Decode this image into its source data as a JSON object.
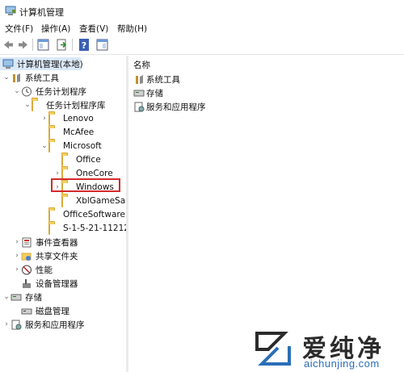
{
  "window": {
    "title": "计算机管理"
  },
  "menu": [
    "文件(F)",
    "操作(A)",
    "查看(V)",
    "帮助(H)"
  ],
  "toolbar": {
    "buttons": [
      "back-arrow-icon",
      "forward-arrow-icon",
      "show-hide-console-tree-icon",
      "export-list-icon",
      "help-icon",
      "action-pane-icon"
    ]
  },
  "tree": {
    "root": "计算机管理(本地)",
    "system_tools": "系统工具",
    "task_scheduler": "任务计划程序",
    "task_library": "任务计划程序库",
    "lenovo": "Lenovo",
    "mcafee": "McAfee",
    "microsoft": "Microsoft",
    "office": "Office",
    "onecore": "OneCore",
    "windows": "Windows",
    "xblgamesave": "XblGameSa",
    "officesoftware": "OfficeSoftware",
    "sid": "S-1-5-21-11212",
    "event_viewer": "事件查看器",
    "shared_folders": "共享文件夹",
    "performance": "性能",
    "device_manager": "设备管理器",
    "storage": "存储",
    "disk_management": "磁盘管理",
    "services_apps": "服务和应用程序"
  },
  "list": {
    "column_name": "名称",
    "items": [
      "系统工具",
      "存储",
      "服务和应用程序"
    ]
  },
  "watermark": {
    "cn": "爱纯净",
    "en": "aichunjing.com"
  },
  "colors": {
    "selection": "#dbe9f9",
    "highlight_border": "#d42a2a",
    "folder": "#f5cf5e",
    "watermark_blue": "#2a6fb8"
  }
}
